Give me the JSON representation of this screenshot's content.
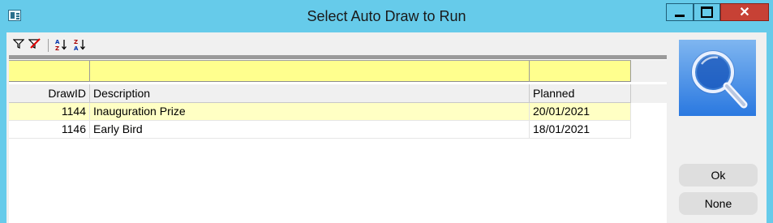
{
  "window": {
    "title": "Select Auto Draw to Run",
    "app_icon": "form-window-icon",
    "minimize_icon": "minimize-icon",
    "maximize_icon": "maximize-icon",
    "close_icon": "close-icon",
    "close_glyph": "✕"
  },
  "toolbar": {
    "filter_icon": "filter-icon",
    "clear_filter_icon": "clear-filter-icon",
    "sort_ascending_icon": "sort-ascending-icon",
    "sort_descending_icon": "sort-descending-icon"
  },
  "filters": {
    "drawid": "",
    "description": "",
    "planned": ""
  },
  "table": {
    "columns": [
      "DrawID",
      "Description",
      "Planned"
    ],
    "rows": [
      {
        "drawid": "1144",
        "description": "Inauguration Prize",
        "planned": "20/01/2021",
        "selected": true
      },
      {
        "drawid": "1146",
        "description": "Early Bird",
        "planned": "18/01/2021",
        "selected": false
      }
    ]
  },
  "side": {
    "logo_icon": "magnifier-icon",
    "ok_label": "Ok",
    "none_label": "None"
  },
  "colors": {
    "title_bar": "#66cbea",
    "close_button": "#c74135",
    "filter_row": "#ffff8e",
    "selected_row": "#ffffc4",
    "logo_top": "#7fb6f0",
    "logo_bottom": "#2a78e0"
  }
}
